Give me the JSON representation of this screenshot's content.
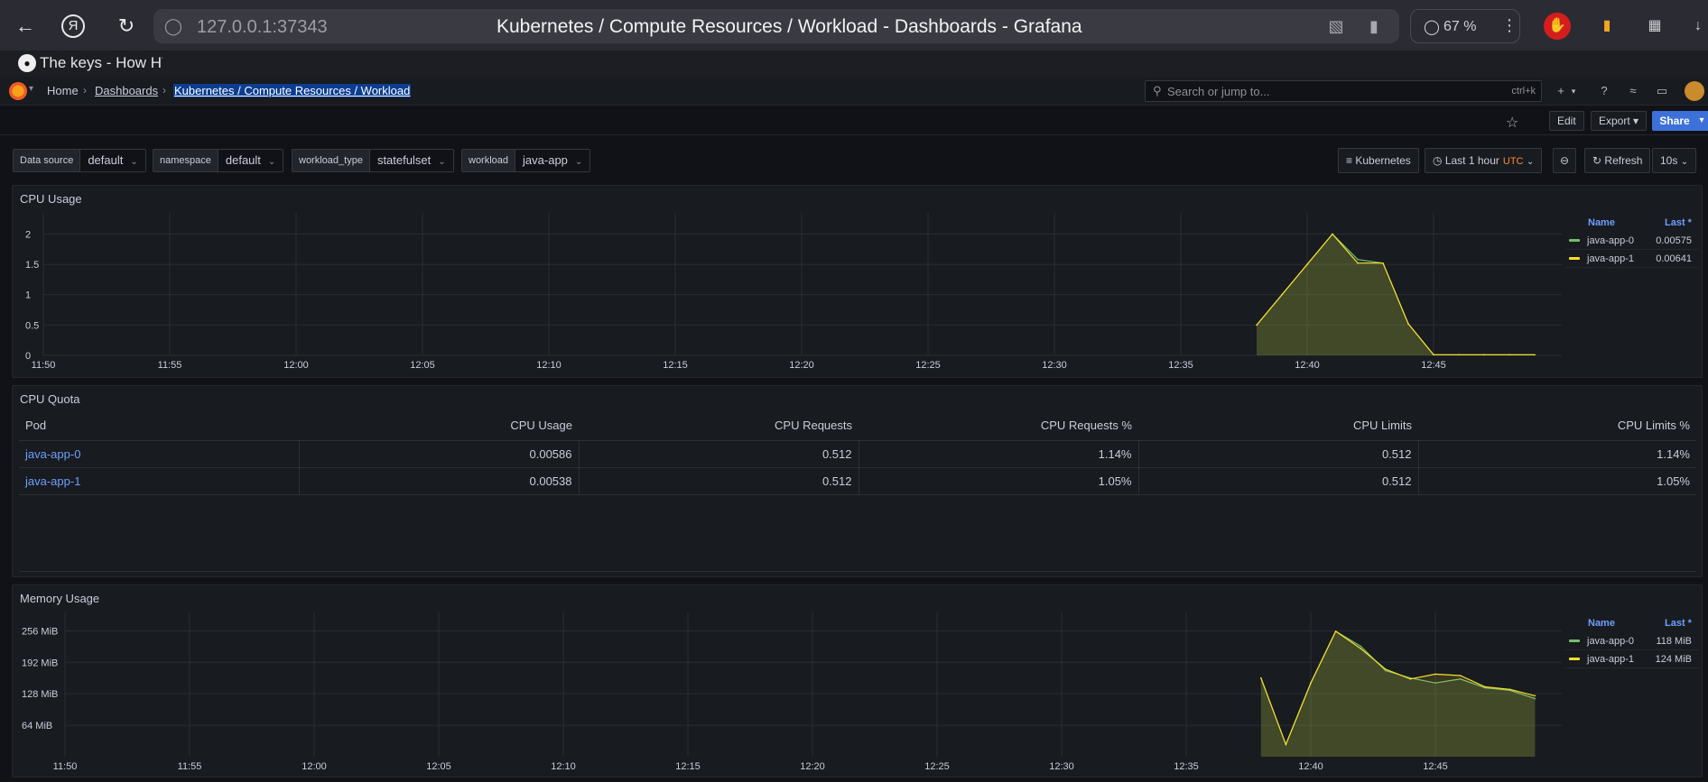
{
  "browser": {
    "url": "127.0.0.1:37343",
    "page_title": "Kubernetes / Compute Resources / Workload - Dashboards - Grafana",
    "zoom": "67 %",
    "bookmark_label": "The keys - How HT"
  },
  "nav": {
    "breadcrumbs": [
      "Home",
      "Dashboards",
      "Kubernetes / Compute Resources / Workload"
    ],
    "search_placeholder": "Search or jump to...",
    "search_shortcut": "ctrl+k"
  },
  "toolbar": {
    "edit": "Edit",
    "export": "Export",
    "share": "Share"
  },
  "variables": [
    {
      "label": "Data source",
      "value": "default"
    },
    {
      "label": "namespace",
      "value": "default"
    },
    {
      "label": "workload_type",
      "value": "statefulset"
    },
    {
      "label": "workload",
      "value": "java-app"
    }
  ],
  "time_controls": {
    "dashboards_link": "Kubernetes",
    "range": "Last 1 hour",
    "tz": "UTC",
    "refresh": "Refresh",
    "interval": "10s"
  },
  "colors": {
    "series_green": "#73bf69",
    "series_yellow": "#fade2a",
    "accent_blue": "#3d71d9",
    "link_blue": "#6e9fff"
  },
  "cpu_usage_panel": {
    "title": "CPU Usage",
    "legend_headers": {
      "name": "Name",
      "last": "Last *"
    },
    "legend": [
      {
        "name": "java-app-0",
        "last": "0.00575",
        "color": "#73bf69"
      },
      {
        "name": "java-app-1",
        "last": "0.00641",
        "color": "#fade2a"
      }
    ]
  },
  "cpu_quota_panel": {
    "title": "CPU Quota",
    "columns": [
      "Pod",
      "CPU Usage",
      "CPU Requests",
      "CPU Requests %",
      "CPU Limits",
      "CPU Limits %"
    ],
    "rows": [
      [
        "java-app-0",
        "0.00586",
        "0.512",
        "1.14%",
        "0.512",
        "1.14%"
      ],
      [
        "java-app-1",
        "0.00538",
        "0.512",
        "1.05%",
        "0.512",
        "1.05%"
      ]
    ]
  },
  "memory_usage_panel": {
    "title": "Memory Usage",
    "legend_headers": {
      "name": "Name",
      "last": "Last *"
    },
    "legend": [
      {
        "name": "java-app-0",
        "last": "118 MiB",
        "color": "#73bf69"
      },
      {
        "name": "java-app-1",
        "last": "124 MiB",
        "color": "#fade2a"
      }
    ]
  },
  "chart_data": [
    {
      "type": "area",
      "title": "CPU Usage",
      "x_ticks": [
        "11:50",
        "11:55",
        "12:00",
        "12:05",
        "12:10",
        "12:15",
        "12:20",
        "12:25",
        "12:30",
        "12:35",
        "12:40",
        "12:45"
      ],
      "y_ticks": [
        "0",
        "0.5",
        "1",
        "1.5",
        "2"
      ],
      "ylim": [
        0,
        2.2
      ],
      "x": [
        "12:38",
        "12:39",
        "12:40",
        "12:41",
        "12:42",
        "12:43",
        "12:44",
        "12:45",
        "12:46",
        "12:47",
        "12:48",
        "12:49"
      ],
      "series": [
        {
          "name": "java-app-0",
          "values": [
            0.5,
            1.0,
            1.5,
            2.0,
            1.58,
            1.52,
            0.52,
            0.01,
            0.01,
            0.01,
            0.01,
            0.01
          ]
        },
        {
          "name": "java-app-1",
          "values": [
            0.5,
            1.0,
            1.5,
            2.0,
            1.52,
            1.52,
            0.52,
            0.01,
            0.01,
            0.01,
            0.01,
            0.01
          ]
        }
      ],
      "grid": true,
      "legend": "right"
    },
    {
      "type": "area",
      "title": "Memory Usage",
      "x_ticks": [
        "11:50",
        "11:55",
        "12:00",
        "12:05",
        "12:10",
        "12:15",
        "12:20",
        "12:25",
        "12:30",
        "12:35",
        "12:40",
        "12:45"
      ],
      "y_ticks": [
        "64 MiB",
        "128 MiB",
        "192 MiB",
        "256 MiB"
      ],
      "ylim_mib": [
        0,
        275
      ],
      "x": [
        "12:38",
        "12:39",
        "12:40",
        "12:41",
        "12:42",
        "12:43",
        "12:44",
        "12:45",
        "12:46",
        "12:47",
        "12:48",
        "12:49"
      ],
      "series": [
        {
          "name": "java-app-0",
          "values": [
            160,
            25,
            150,
            255,
            225,
            175,
            160,
            150,
            158,
            140,
            135,
            118
          ]
        },
        {
          "name": "java-app-1",
          "values": [
            160,
            25,
            150,
            255,
            220,
            178,
            158,
            168,
            165,
            142,
            137,
            124
          ]
        }
      ],
      "grid": true,
      "legend": "right"
    }
  ]
}
